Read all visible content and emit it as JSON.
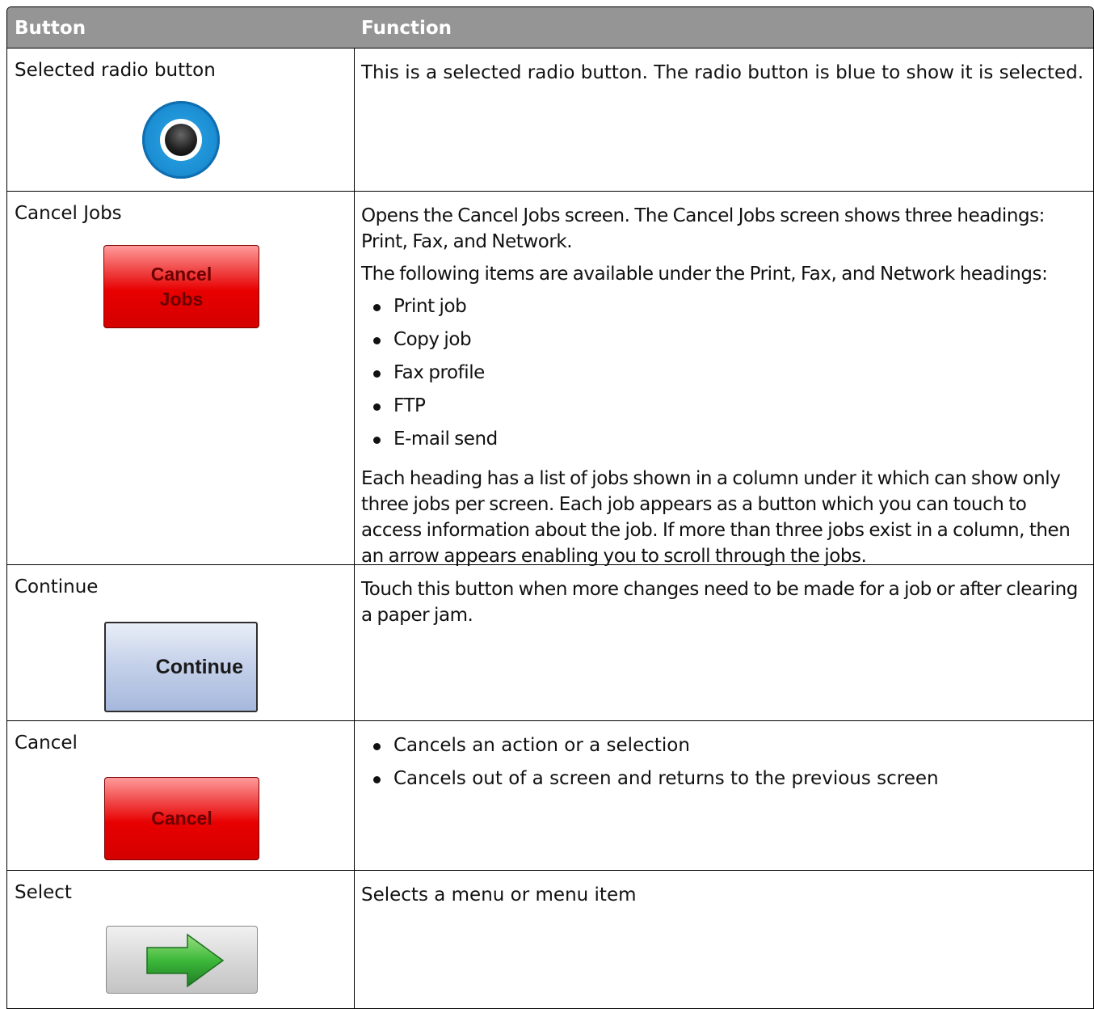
{
  "table": {
    "headers": {
      "button": "Button",
      "function": "Function"
    },
    "rows": [
      {
        "button": "Selected radio button",
        "function": "This is a selected radio button. The radio button is blue to show it is selected."
      },
      {
        "button": "Cancel Jobs",
        "image_label_line1": "Cancel",
        "image_label_line2": "Jobs",
        "function_p1": "Opens the Cancel Jobs screen. The Cancel Jobs screen shows three headings: Print, Fax, and Network.",
        "function_p2": "The following items are available under the Print, Fax, and Network headings:",
        "bullets": [
          "Print job",
          "Copy job",
          "Fax profile",
          "FTP",
          "E-mail send"
        ],
        "function_p3": "Each heading has a list of jobs shown in a column under it which can show only three jobs per screen. Each job appears as a button which you can touch to access information about the job. If more than three jobs exist in a column, then an arrow appears enabling you to scroll through the jobs."
      },
      {
        "button": "Continue",
        "image_label": "Continue",
        "function": "Touch this button when more changes need to be made for a job or after clearing a paper jam."
      },
      {
        "button": "Cancel",
        "image_label": "Cancel",
        "bullets": [
          "Cancels an action or a selection",
          "Cancels out of a screen and returns to the previous screen"
        ]
      },
      {
        "button": "Select",
        "function": "Selects a menu or menu item",
        "icon": "right-arrow-icon"
      }
    ]
  },
  "colors": {
    "header_bg": "#959595",
    "radio_blue": "#1d8fd4",
    "cancel_red": "#e80000",
    "continue_blue": "#b4c4e2",
    "arrow_green": "#2fa52f"
  }
}
